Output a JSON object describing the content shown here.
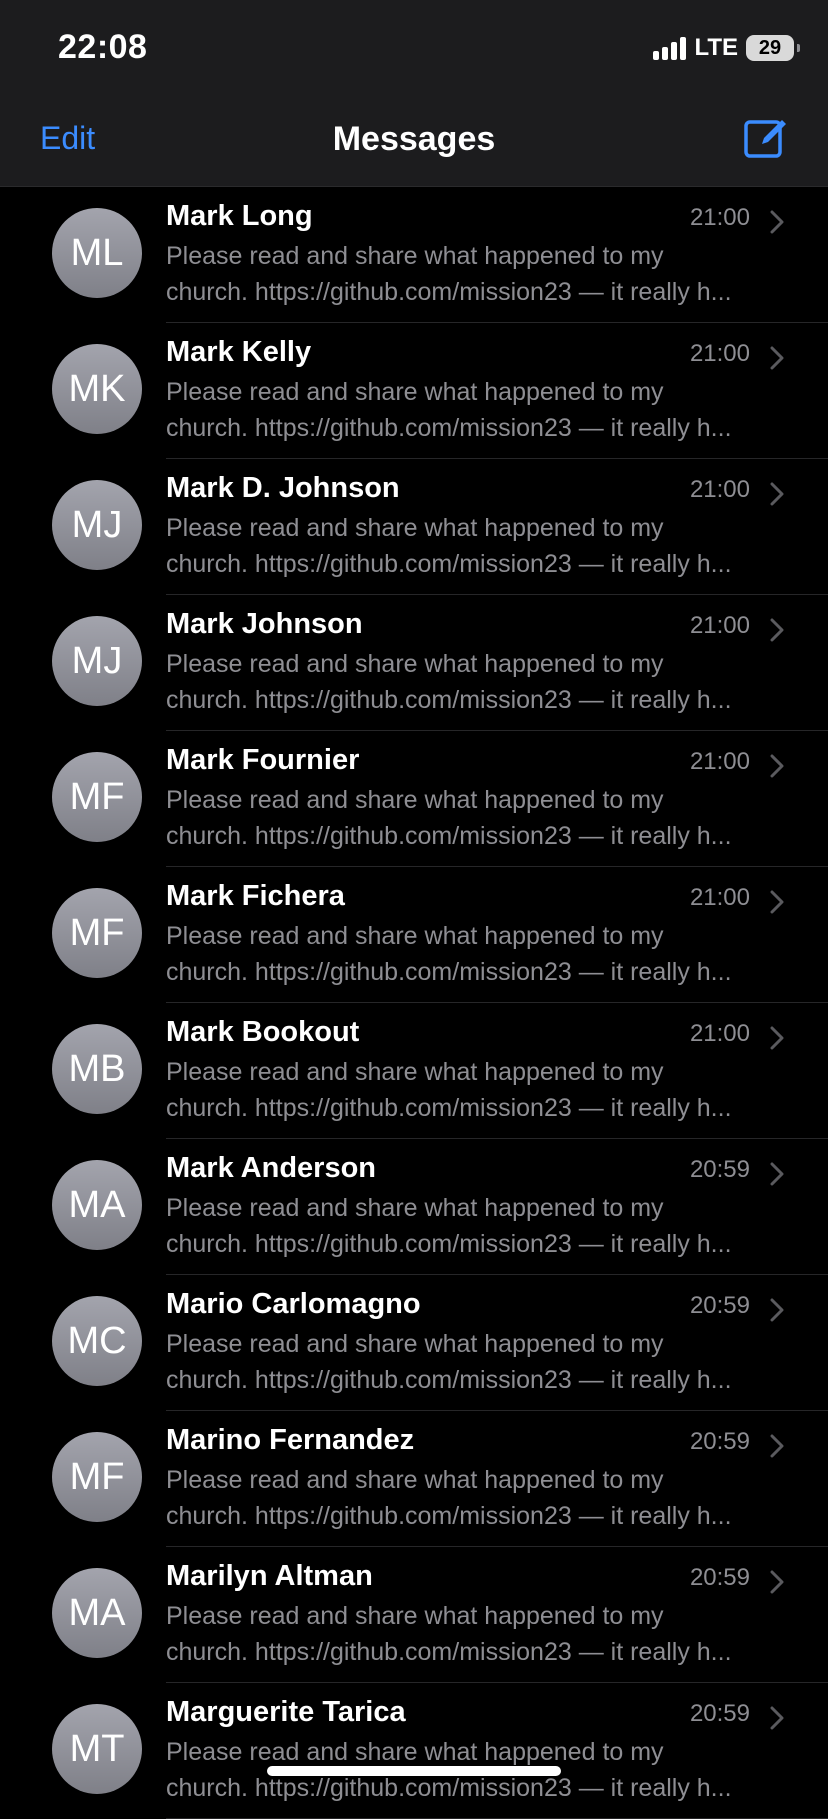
{
  "status_bar": {
    "time": "22:08",
    "network": "LTE",
    "battery": "29"
  },
  "nav": {
    "edit_label": "Edit",
    "title": "Messages",
    "compose_icon": "compose-icon"
  },
  "threads": [
    {
      "initials": "ML",
      "name": "Mark Long",
      "time": "21:00",
      "preview1": "Please read and share what happened to my",
      "preview2": "church. https://github.com/mission23 — it really h..."
    },
    {
      "initials": "MK",
      "name": "Mark Kelly",
      "time": "21:00",
      "preview1": "Please read and share what happened to my",
      "preview2": "church. https://github.com/mission23 — it really h..."
    },
    {
      "initials": "MJ",
      "name": "Mark D. Johnson",
      "time": "21:00",
      "preview1": "Please read and share what happened to my",
      "preview2": "church. https://github.com/mission23 — it really h..."
    },
    {
      "initials": "MJ",
      "name": "Mark Johnson",
      "time": "21:00",
      "preview1": "Please read and share what happened to my",
      "preview2": "church. https://github.com/mission23 — it really h..."
    },
    {
      "initials": "MF",
      "name": "Mark Fournier",
      "time": "21:00",
      "preview1": "Please read and share what happened to my",
      "preview2": "church. https://github.com/mission23 — it really h..."
    },
    {
      "initials": "MF",
      "name": "Mark Fichera",
      "time": "21:00",
      "preview1": "Please read and share what happened to my",
      "preview2": "church. https://github.com/mission23 — it really h..."
    },
    {
      "initials": "MB",
      "name": "Mark Bookout",
      "time": "21:00",
      "preview1": "Please read and share what happened to my",
      "preview2": "church. https://github.com/mission23 — it really h..."
    },
    {
      "initials": "MA",
      "name": "Mark Anderson",
      "time": "20:59",
      "preview1": "Please read and share what happened to my",
      "preview2": "church. https://github.com/mission23 — it really h..."
    },
    {
      "initials": "MC",
      "name": "Mario Carlomagno",
      "time": "20:59",
      "preview1": "Please read and share what happened to my",
      "preview2": "church. https://github.com/mission23 — it really h..."
    },
    {
      "initials": "MF",
      "name": "Marino Fernandez",
      "time": "20:59",
      "preview1": "Please read and share what happened to my",
      "preview2": "church. https://github.com/mission23 — it really h..."
    },
    {
      "initials": "MA",
      "name": "Marilyn Altman",
      "time": "20:59",
      "preview1": "Please read and share what happened to my",
      "preview2": "church. https://github.com/mission23 — it really h..."
    },
    {
      "initials": "MT",
      "name": "Marguerite Tarica",
      "time": "20:59",
      "preview1": "Please read and share what happened to my",
      "preview2": "church. https://github.com/mission23 — it really h..."
    }
  ],
  "colors": {
    "accent": "#3b8cff",
    "background": "#000000",
    "secondary_text": "#8e8e93"
  }
}
